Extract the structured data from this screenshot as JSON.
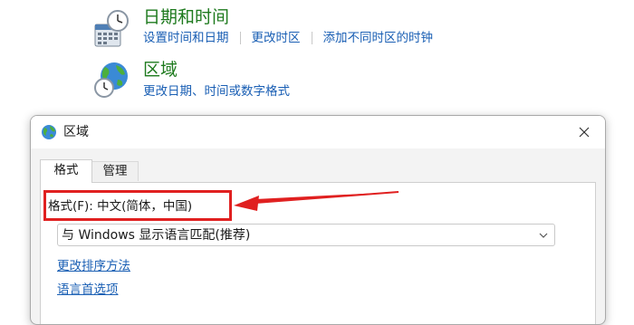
{
  "control_panel": {
    "date_time": {
      "title": "日期和时间",
      "icon": "clock-calendar-icon",
      "links": [
        "设置时间和日期",
        "更改时区",
        "添加不同时区的时钟"
      ]
    },
    "region": {
      "title": "区域",
      "icon": "globe-clock-icon",
      "links": [
        "更改日期、时间或数字格式"
      ]
    }
  },
  "dialog": {
    "title": "区域",
    "icon": "globe-icon",
    "close_icon": "close-icon",
    "tabs": [
      {
        "label": "格式",
        "active": true
      },
      {
        "label": "管理",
        "active": false
      }
    ],
    "format_label": "格式(F): 中文(简体，中国)",
    "format_dropdown": {
      "selected": "与 Windows 显示语言匹配(推荐)"
    },
    "links": [
      "更改排序方法",
      "语言首选项"
    ]
  },
  "annotation": {
    "highlight_color": "#e02020"
  },
  "colors": {
    "title_green": "#1e7a1e",
    "link_blue": "#1a5fb4",
    "dialog_bg": "#f3f3f3"
  }
}
